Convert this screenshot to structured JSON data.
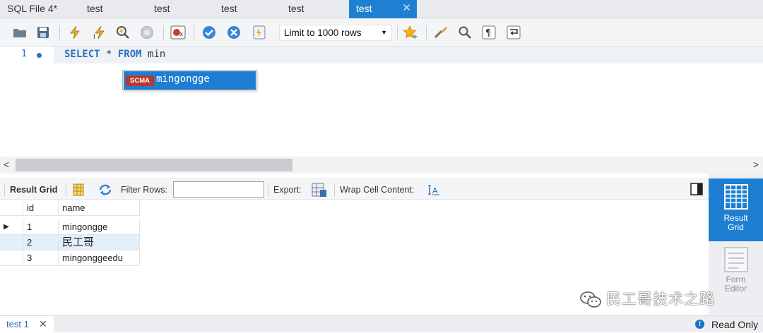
{
  "tabs": [
    {
      "label": "SQL File 4*",
      "active": false
    },
    {
      "label": "test",
      "active": false
    },
    {
      "label": "test",
      "active": false
    },
    {
      "label": "test",
      "active": false
    },
    {
      "label": "test",
      "active": false
    },
    {
      "label": "test",
      "active": true
    }
  ],
  "toolbar": {
    "limit_label": "Limit to 1000 rows"
  },
  "editor": {
    "line_number": "1",
    "code": {
      "select": "SELECT",
      "star": " * ",
      "from": "FROM",
      "rest": " min"
    },
    "autocomplete": {
      "badge": "SCMA",
      "text": "mingongge"
    }
  },
  "result_toolbar": {
    "result_grid": "Result Grid",
    "filter_rows": "Filter Rows:",
    "filter_value": "",
    "export": "Export:",
    "wrap_cell": "Wrap Cell Content:"
  },
  "grid": {
    "columns": [
      "id",
      "name"
    ],
    "rows": [
      {
        "id": "1",
        "name": "mingongge"
      },
      {
        "id": "2",
        "name": "民工哥"
      },
      {
        "id": "3",
        "name": "mingonggeedu"
      }
    ]
  },
  "side_panel": {
    "result_grid": "Result\nGrid",
    "form_editor": "Form\nEditor"
  },
  "status": {
    "tab_label": "test 1",
    "read_only": "Read Only"
  },
  "watermark": "民工哥技术之路",
  "colors": {
    "accent": "#1e80d0",
    "badge": "#b7382f",
    "keyword": "#2a6fc0"
  }
}
